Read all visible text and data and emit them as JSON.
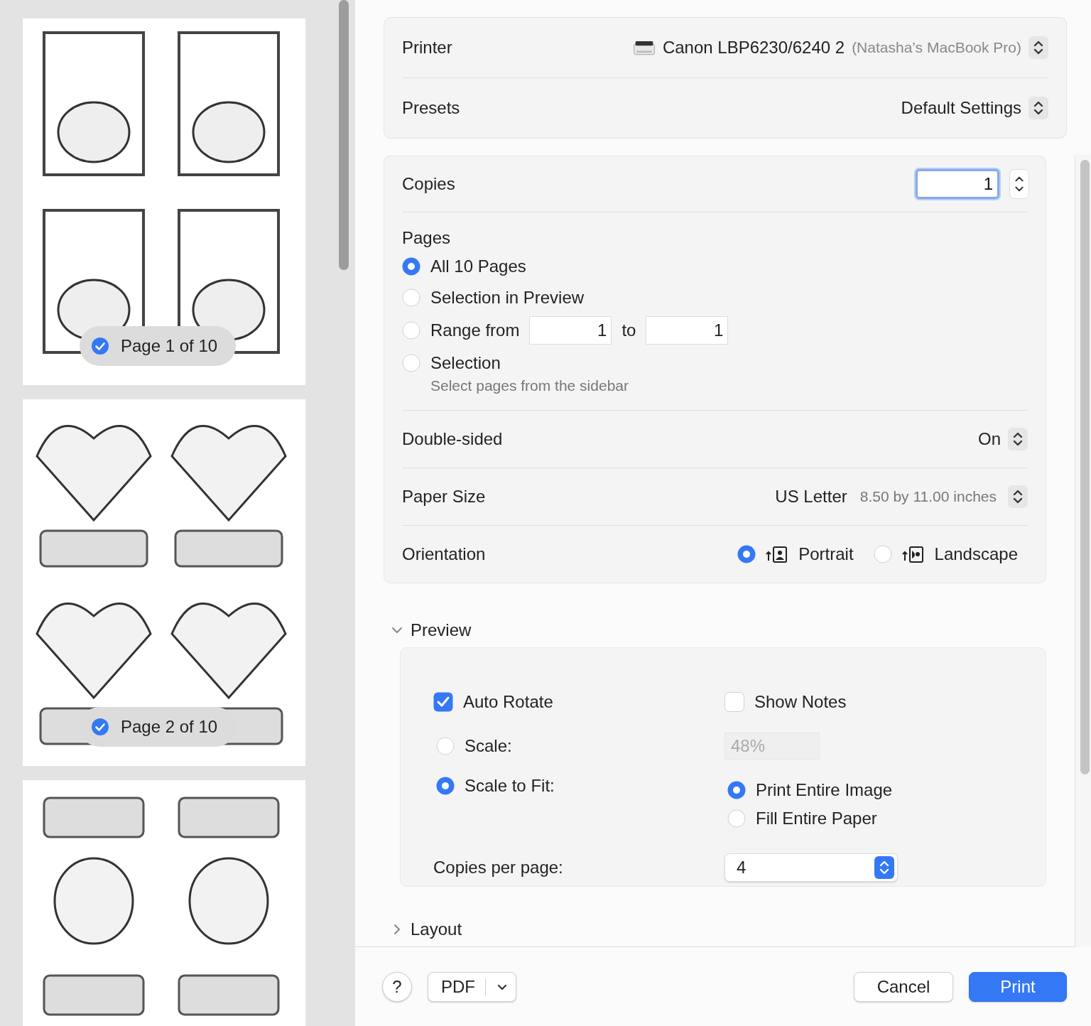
{
  "sidebar": {
    "pages": [
      {
        "kind": "picture",
        "badge": "Page 1 of 10",
        "selected": true
      },
      {
        "kind": "picture",
        "badge": "Page 2 of 10",
        "selected": true
      },
      {
        "kind": "picture"
      }
    ]
  },
  "printer": {
    "label": "Printer",
    "name": "Canon LBP6230/6240 2",
    "location": "(Natasha’s MacBook Pro)"
  },
  "presets": {
    "label": "Presets",
    "value": "Default Settings"
  },
  "copies": {
    "label": "Copies",
    "value": "1"
  },
  "pages": {
    "label": "Pages",
    "options": [
      {
        "kind": "plain",
        "label": "All 10 Pages",
        "selected": true
      },
      {
        "kind": "plain",
        "label": "Selection in Preview",
        "selected": false
      },
      {
        "kind": "range",
        "label": "Range from",
        "from": "1",
        "to_label": "to",
        "to": "1",
        "selected": false
      },
      {
        "kind": "hint",
        "label": "Selection",
        "hint": "Select pages from the sidebar",
        "selected": false
      }
    ]
  },
  "double_sided": {
    "label": "Double-sided",
    "value": "On"
  },
  "paper_size": {
    "label": "Paper Size",
    "value": "US Letter",
    "detail": "8.50 by 11.00 inches"
  },
  "orientation": {
    "label": "Orientation",
    "options": [
      {
        "kind": "portrait",
        "label": "Portrait",
        "selected": true
      },
      {
        "kind": "landscape",
        "label": "Landscape",
        "selected": false
      }
    ]
  },
  "preview": {
    "title": "Preview",
    "expanded": true,
    "auto_rotate": {
      "label": "Auto Rotate",
      "checked": true
    },
    "show_notes": {
      "label": "Show Notes",
      "checked": false
    },
    "scale": {
      "label": "Scale:",
      "selected": false,
      "value": "48%",
      "disabled": true
    },
    "scale_to_fit": {
      "label": "Scale to Fit:",
      "selected": true,
      "options": [
        {
          "label": "Print Entire Image",
          "selected": true
        },
        {
          "label": "Fill Entire Paper",
          "selected": false
        }
      ]
    },
    "copies_per_page": {
      "label": "Copies per page:",
      "value": "4"
    }
  },
  "layout": {
    "title": "Layout",
    "expanded": false
  },
  "footer": {
    "help": "?",
    "pdf": "PDF",
    "cancel": "Cancel",
    "print": "Print"
  }
}
